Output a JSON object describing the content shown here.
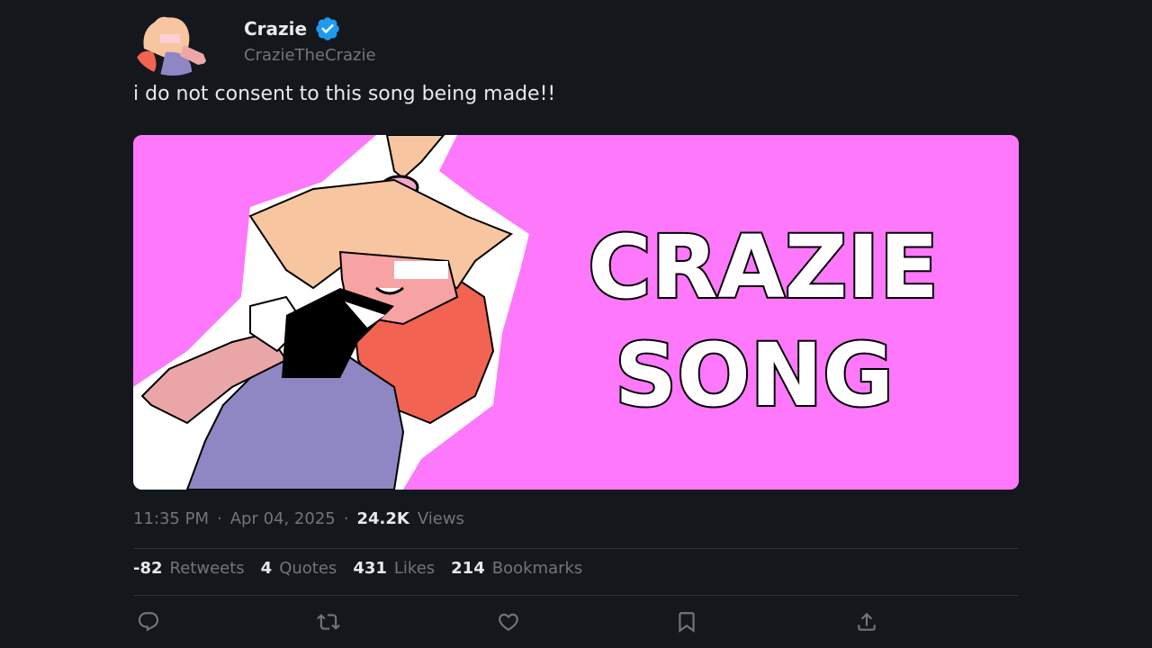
{
  "author": {
    "name": "Crazie",
    "handle": "CrazieTheCrazie",
    "verified": true
  },
  "tweet": {
    "text": "i do not consent to this song being made!!"
  },
  "media": {
    "title_line1": "CRAZIE",
    "title_line2": "SONG",
    "background_color": "#fd78fb"
  },
  "meta": {
    "time": "11:35 PM",
    "sep1": "·",
    "date": "Apr 04, 2025",
    "sep2": "·",
    "views_count": "24.2K",
    "views_label": "Views"
  },
  "stats": {
    "retweets": {
      "count": "-82",
      "label": "Retweets"
    },
    "quotes": {
      "count": "4",
      "label": "Quotes"
    },
    "likes": {
      "count": "431",
      "label": "Likes"
    },
    "bookmarks": {
      "count": "214",
      "label": "Bookmarks"
    }
  },
  "actions": [
    {
      "icon": "reply-icon"
    },
    {
      "icon": "retweet-icon"
    },
    {
      "icon": "like-icon"
    },
    {
      "icon": "bookmark-icon"
    },
    {
      "icon": "share-icon"
    }
  ],
  "colors": {
    "background": "#14171b",
    "text_primary": "#e7e9ea",
    "text_secondary": "#71767b",
    "verified_blue": "#1d9bf0"
  }
}
